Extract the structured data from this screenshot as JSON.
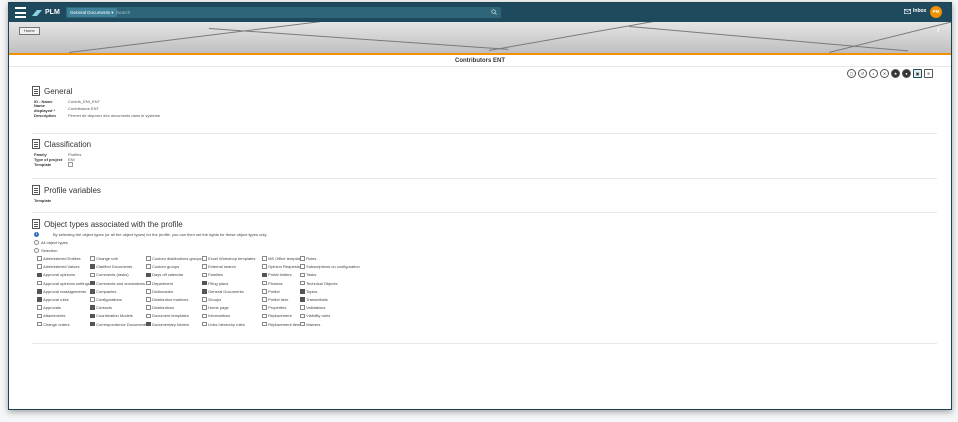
{
  "header": {
    "app_name": "PLM",
    "search_scope": "General Documents",
    "search_placeholder": "Search",
    "inbox_label": "Inbox",
    "user_initials": "PM"
  },
  "banner": {
    "back_label": "Home",
    "right_icon": "I"
  },
  "page": {
    "title": "Contributors ENT"
  },
  "toolbar": {
    "buttons": [
      {
        "name": "copy-icon",
        "glyph": "▢"
      },
      {
        "name": "history-icon",
        "glyph": "↺"
      },
      {
        "name": "moon-icon",
        "glyph": "◐"
      },
      {
        "name": "close-icon",
        "glyph": "✕"
      },
      {
        "name": "star-icon",
        "glyph": "★"
      },
      {
        "name": "user-icon",
        "glyph": "●"
      },
      {
        "name": "edit-icon",
        "glyph": "▣"
      },
      {
        "name": "rss-icon",
        "glyph": "≋"
      }
    ]
  },
  "general": {
    "title": "General",
    "rows": [
      {
        "label": "ID - Name",
        "value": "Contrib_ENI_ENT"
      },
      {
        "label": "Name displayed *",
        "value": "Contributors ENT"
      },
      {
        "label": "Description",
        "value": "Permet de déposer des documents dans le système"
      }
    ]
  },
  "classification": {
    "title": "Classification",
    "rows": [
      {
        "label": "Family",
        "value": "Profiles"
      },
      {
        "label": "Type of project",
        "value": "ENI"
      },
      {
        "label": "Template",
        "value": ""
      }
    ]
  },
  "profile_variables": {
    "title": "Profile variables",
    "rows": [
      {
        "label": "Template",
        "value": ""
      }
    ]
  },
  "object_types": {
    "title": "Object types associated with the profile",
    "info": "By selecting the object types (or all the object types) for the profile, you can then set the rights for these object types only.",
    "all_label": "All object types",
    "selection_label": "Selection",
    "columns": [
      [
        {
          "label": "Administered Entities",
          "checked": false
        },
        {
          "label": "Administered Values",
          "checked": false
        },
        {
          "label": "Approval opinions",
          "checked": true
        },
        {
          "label": "Approval opinions settings",
          "checked": false
        },
        {
          "label": "Approval reassignments",
          "checked": true
        },
        {
          "label": "Approval rules",
          "checked": true
        },
        {
          "label": "Approvals",
          "checked": false
        },
        {
          "label": "Attachments",
          "checked": false
        },
        {
          "label": "Change orders",
          "checked": false
        }
      ],
      [
        {
          "label": "Change unit",
          "checked": false
        },
        {
          "label": "Clarified Documents",
          "checked": true
        },
        {
          "label": "Comments (tasks)",
          "checked": false
        },
        {
          "label": "Comments and annotations",
          "checked": true
        },
        {
          "label": "Companies",
          "checked": true
        },
        {
          "label": "Configurations",
          "checked": false
        },
        {
          "label": "Contacts",
          "checked": true
        },
        {
          "label": "Coordination Models",
          "checked": true
        },
        {
          "label": "Correspondence Documents",
          "checked": true
        }
      ],
      [
        {
          "label": "Custom distributions groups",
          "checked": false
        },
        {
          "label": "Custom groups",
          "checked": false
        },
        {
          "label": "Days off calendar",
          "checked": true
        },
        {
          "label": "Department",
          "checked": false
        },
        {
          "label": "Dictionaries",
          "checked": false
        },
        {
          "label": "Distribution matrices",
          "checked": false
        },
        {
          "label": "Distributions",
          "checked": false
        },
        {
          "label": "Document templates",
          "checked": false
        },
        {
          "label": "Documentary folders",
          "checked": true
        }
      ],
      [
        {
          "label": "Excel Workshop templates",
          "checked": false
        },
        {
          "label": "External search",
          "checked": false
        },
        {
          "label": "Families",
          "checked": false
        },
        {
          "label": "Filing plans",
          "checked": true
        },
        {
          "label": "General Documents",
          "checked": true
        },
        {
          "label": "Groups",
          "checked": false
        },
        {
          "label": "Home page",
          "checked": false
        },
        {
          "label": "Informations",
          "checked": false
        },
        {
          "label": "Links hierarchy rules",
          "checked": false
        }
      ],
      [
        {
          "label": "MS Office templates",
          "checked": false
        },
        {
          "label": "Opinion Requests",
          "checked": false
        },
        {
          "label": "Portal folders",
          "checked": true
        },
        {
          "label": "Pictures",
          "checked": false
        },
        {
          "label": "Portlet",
          "checked": false
        },
        {
          "label": "Portlet item",
          "checked": false
        },
        {
          "label": "Properties",
          "checked": false
        },
        {
          "label": "Replacement",
          "checked": false
        },
        {
          "label": "Replacement item",
          "checked": false
        }
      ],
      [
        {
          "label": "Roles",
          "checked": false
        },
        {
          "label": "Subscriptions on configuration",
          "checked": false
        },
        {
          "label": "Tasks",
          "checked": false
        },
        {
          "label": "Technical Objects",
          "checked": false
        },
        {
          "label": "Topics",
          "checked": true
        },
        {
          "label": "Transmittals",
          "checked": true
        },
        {
          "label": "Validations",
          "checked": false
        },
        {
          "label": "Visibility rules",
          "checked": false
        },
        {
          "label": "Waivers",
          "checked": false
        }
      ]
    ]
  }
}
